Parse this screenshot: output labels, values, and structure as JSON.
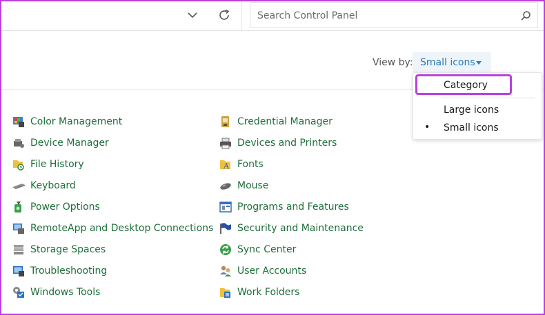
{
  "address_bar": {
    "chevron_icon": "chevron-down-icon",
    "refresh_icon": "refresh-icon"
  },
  "search": {
    "placeholder": "Search Control Panel",
    "value": "",
    "icon": "search-icon"
  },
  "view_by": {
    "label": "View by:",
    "selected": "Small icons",
    "options": [
      {
        "label": "Category",
        "selected": false,
        "highlighted": true
      },
      {
        "label": "Large icons",
        "selected": false,
        "highlighted": false
      },
      {
        "label": "Small icons",
        "selected": true,
        "highlighted": false
      }
    ],
    "bullet": "•"
  },
  "items": {
    "left": [
      {
        "label": "Color Management",
        "icon": "color-management-icon"
      },
      {
        "label": "Device Manager",
        "icon": "device-manager-icon"
      },
      {
        "label": "File History",
        "icon": "file-history-icon"
      },
      {
        "label": "Keyboard",
        "icon": "keyboard-icon"
      },
      {
        "label": "Power Options",
        "icon": "power-options-icon"
      },
      {
        "label": "RemoteApp and Desktop Connections",
        "icon": "remoteapp-icon"
      },
      {
        "label": "Storage Spaces",
        "icon": "storage-spaces-icon"
      },
      {
        "label": "Troubleshooting",
        "icon": "troubleshooting-icon"
      },
      {
        "label": "Windows Tools",
        "icon": "windows-tools-icon"
      }
    ],
    "right": [
      {
        "label": "Credential Manager",
        "icon": "credential-manager-icon"
      },
      {
        "label": "Devices and Printers",
        "icon": "devices-printers-icon"
      },
      {
        "label": "Fonts",
        "icon": "fonts-icon"
      },
      {
        "label": "Mouse",
        "icon": "mouse-icon"
      },
      {
        "label": "Programs and Features",
        "icon": "programs-features-icon"
      },
      {
        "label": "Security and Maintenance",
        "icon": "security-flag-icon"
      },
      {
        "label": "Sync Center",
        "icon": "sync-center-icon"
      },
      {
        "label": "User Accounts",
        "icon": "user-accounts-icon"
      },
      {
        "label": "Work Folders",
        "icon": "work-folders-icon"
      }
    ]
  },
  "colors": {
    "link_green": "#1e6e3a",
    "accent_blue": "#2a7ab9",
    "highlight_purple": "#b93fe3"
  }
}
